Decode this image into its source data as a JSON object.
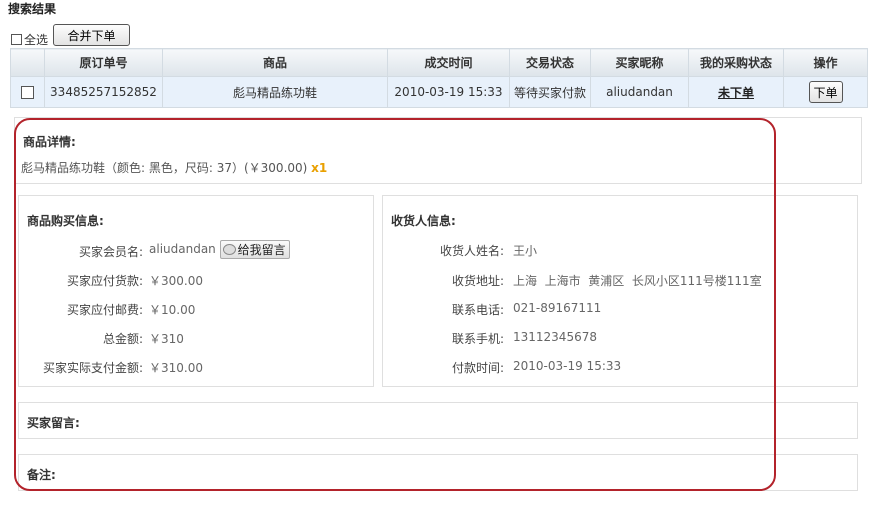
{
  "page": {
    "title": "搜索结果"
  },
  "toolbar": {
    "select_all_label": "全选",
    "merge_order_label": "合并下单"
  },
  "table": {
    "headers": [
      "原订单号",
      "商品",
      "成交时间",
      "交易状态",
      "买家昵称",
      "我的采购状态",
      "操作"
    ],
    "row": {
      "order_no": "33485257152852",
      "product": "彪马精品练功鞋",
      "time": "2010-03-19 15:33",
      "trade_status": "等待买家付款",
      "buyer": "aliudandan",
      "purchase_status": "未下单",
      "action": "下单"
    }
  },
  "details": {
    "title": "商品详情:",
    "product_line": "彪马精品练功鞋（颜色: 黑色，尺码: 37）(￥300.00)",
    "qty": "x1"
  },
  "purchase_info": {
    "title": "商品购买信息:",
    "member_label": "买家会员名:",
    "member_value": "aliudandan",
    "message_button": "给我留言",
    "rows": [
      {
        "label": "买家应付货款:",
        "value": "￥300.00"
      },
      {
        "label": "买家应付邮费:",
        "value": "￥10.00"
      },
      {
        "label": "总金额:",
        "value": "￥310"
      },
      {
        "label": "买家实际支付金额:",
        "value": "￥310.00"
      }
    ]
  },
  "receiver_info": {
    "title": "收货人信息:",
    "rows": [
      {
        "label": "收货人姓名:",
        "value": "王小"
      },
      {
        "label": "收货地址:",
        "value": "上海  上海市  黄浦区  长风小区111号楼111室"
      },
      {
        "label": "联系电话:",
        "value": "021-89167111"
      },
      {
        "label": "联系手机:",
        "value": "13112345678"
      },
      {
        "label": "付款时间:",
        "value": "2010-03-19 15:33"
      }
    ]
  },
  "buyer_message": {
    "label": "买家留言:"
  },
  "remark": {
    "label": "备注:"
  },
  "colors": {
    "highlight_ring": "#b3232b",
    "row_bg": "#e8f1fb",
    "qty": "#e9a000"
  }
}
